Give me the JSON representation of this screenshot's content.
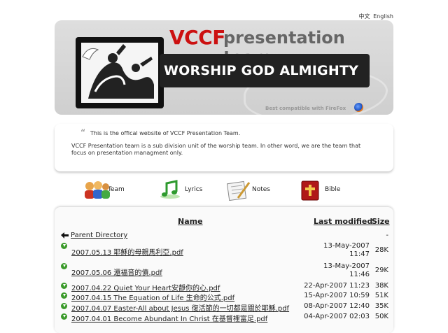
{
  "language": {
    "chinese": "中文",
    "english": "English"
  },
  "banner": {
    "title_brand": "VCCF",
    "title_rest": "presentation team",
    "tagline": "WORSHIP GOD ALMIGHTY",
    "compat": "Best compatible with FireFox"
  },
  "intro": {
    "line1": "This is the offical website of VCCF Presentation Team.",
    "para": "VCCF Presentation team is a sub division unit of the worship team. In other word, we are the team that focus on presentation managment only."
  },
  "nav": [
    {
      "label": "Team",
      "icon": "team-icon"
    },
    {
      "label": "Lyrics",
      "icon": "music-note-icon"
    },
    {
      "label": "Notes",
      "icon": "notes-icon"
    },
    {
      "label": "Bible",
      "icon": "bible-icon"
    }
  ],
  "listing": {
    "headers": {
      "name": "Name",
      "modified": "Last modified",
      "size": "Size"
    },
    "parent": {
      "name": "Parent Directory",
      "size": "-"
    },
    "files": [
      {
        "name": "2007.05.13 耶穌的母親馬利亞.pdf",
        "date": "13-May-2007",
        "time": "11:47",
        "size": "28K"
      },
      {
        "name": "2007.05.06 還福音的債.pdf",
        "date": "13-May-2007",
        "time": "11:46",
        "size": "29K"
      },
      {
        "name": "2007.04.22 Quiet Your Heart安靜你的心.pdf",
        "date": "22-Apr-2007 11:23",
        "time": "",
        "size": "38K"
      },
      {
        "name": "2007.04.15 The Equation of Life 生命的公式.pdf",
        "date": "15-Apr-2007 10:59",
        "time": "",
        "size": "51K"
      },
      {
        "name": "2007.04.07 Easter-All about Jesus 復活節的一切都是關於耶穌.pdf",
        "date": "08-Apr-2007 12:40",
        "time": "",
        "size": "35K"
      },
      {
        "name": "2007.04.01 Become Abundant In Christ 在基督裡富足.pdf",
        "date": "04-Apr-2007 02:03",
        "time": "",
        "size": "50K"
      }
    ]
  }
}
